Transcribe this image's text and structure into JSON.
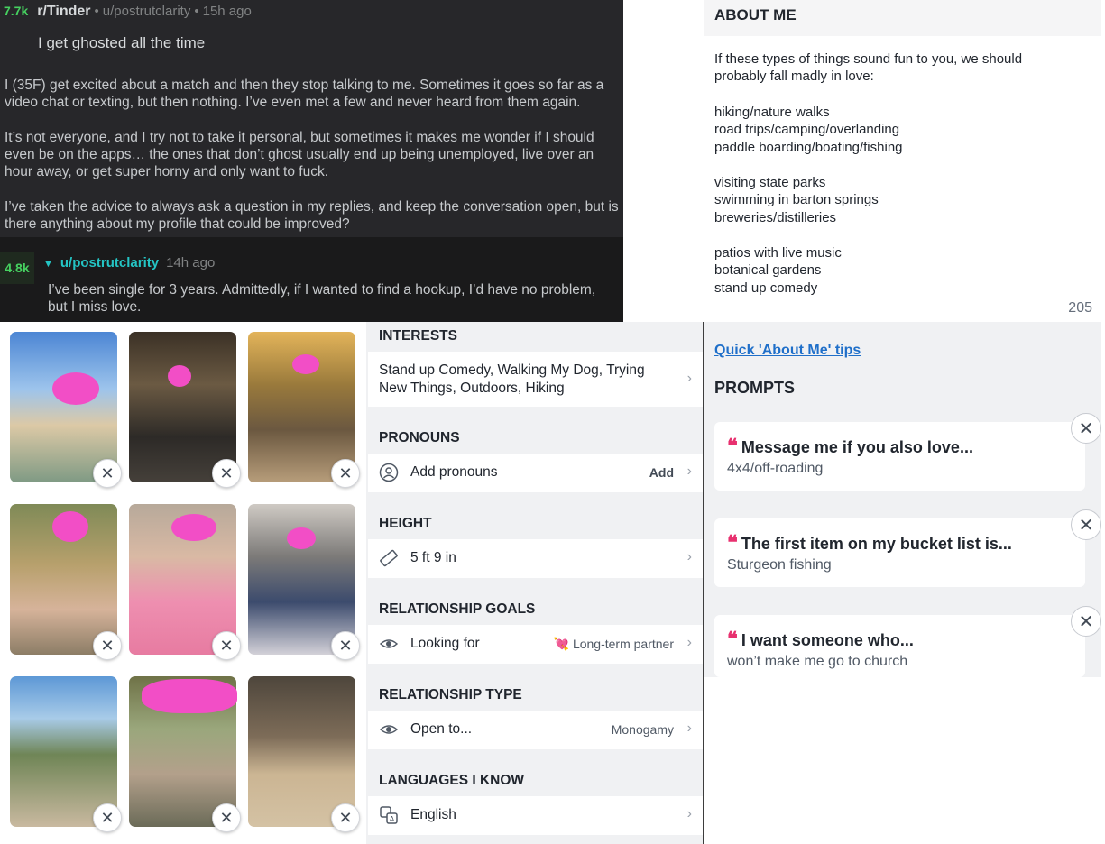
{
  "reddit": {
    "score": "7.7k",
    "subreddit": "r/Tinder",
    "sep": "•",
    "user": "u/postrutclarity",
    "time": "15h ago",
    "title": "I get ghosted all the time",
    "paragraphs": [
      "I (35F) get excited about a match and then they stop talking to me. Sometimes it goes so far as a video chat or texting, but then nothing. I’ve even met a few and never heard from them again.",
      "It’s not everyone, and I try not to take it personal, but sometimes it makes me wonder if I should even be on the apps… the ones that don’t ghost usually end up being unemployed, live over an hour away, or get super horny and only want to fuck.",
      "I’ve taken the advice to always ask a question in my replies, and keep the conversation open, but is there anything about my profile that could be improved?"
    ],
    "comment": {
      "score": "4.8k",
      "collapse_glyph": "▼",
      "user": "u/postrutclarity",
      "time": "14h ago",
      "text": "I’ve been single for 3 years. Admittedly, if I wanted to find a hookup, I’d have no problem, but I miss love."
    }
  },
  "about": {
    "header": "ABOUT ME",
    "lines": [
      "If these types of things sound fun to you, we should",
      "probably fall madly in love:",
      "hiking/nature walks",
      "road trips/camping/overlanding",
      "paddle boarding/boating/fishing",
      "visiting state parks",
      "swimming in barton springs",
      "breweries/distilleries",
      "patios with live music",
      "botanical gardens",
      "stand up comedy"
    ],
    "char_count": "205"
  },
  "photos": {
    "remove_glyph": "✕",
    "items": [
      {
        "label": "photo-1"
      },
      {
        "label": "photo-2"
      },
      {
        "label": "photo-3"
      },
      {
        "label": "photo-4"
      },
      {
        "label": "photo-5"
      },
      {
        "label": "photo-6"
      },
      {
        "label": "photo-7"
      },
      {
        "label": "photo-8"
      },
      {
        "label": "photo-9"
      }
    ]
  },
  "profile": {
    "interests": {
      "title": "INTERESTS",
      "value": "Stand up Comedy, Walking My Dog, Trying New Things, Outdoors, Hiking"
    },
    "pronouns": {
      "title": "PRONOUNS",
      "label": "Add pronouns",
      "action": "Add"
    },
    "height": {
      "title": "HEIGHT",
      "label": "5 ft 9 in"
    },
    "goals": {
      "title": "RELATIONSHIP GOALS",
      "label": "Looking for",
      "value": "Long-term partner",
      "emoji": "💘"
    },
    "type": {
      "title": "RELATIONSHIP TYPE",
      "label": "Open to...",
      "value": "Monogamy"
    },
    "languages": {
      "title": "LANGUAGES I KNOW",
      "label": "English"
    },
    "chevron": "›"
  },
  "prompts": {
    "tips_link": "Quick 'About Me' tips",
    "header": "PROMPTS",
    "quote_glyph": "❝",
    "remove_glyph": "✕",
    "items": [
      {
        "question": "Message me if you also love...",
        "answer": "4x4/off-roading"
      },
      {
        "question": "The first item on my bucket list is...",
        "answer": "Sturgeon fishing"
      },
      {
        "question": "I want someone who...",
        "answer": "won’t make me go to church"
      }
    ]
  },
  "colors": {
    "accent_pink": "#e8306f",
    "link_blue": "#1f6fc9",
    "reddit_green": "#46d160",
    "reddit_teal": "#24c4c4"
  }
}
